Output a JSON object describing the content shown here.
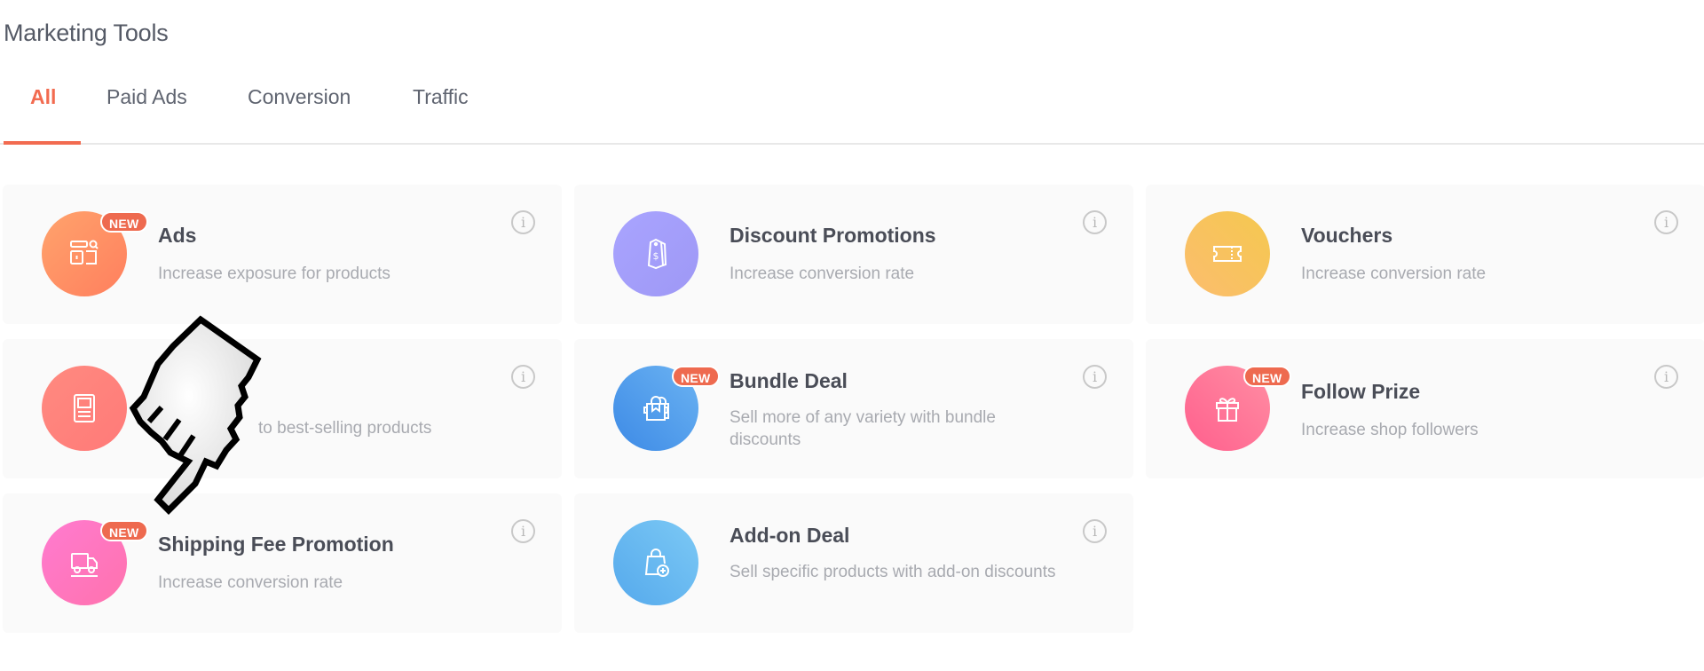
{
  "page": {
    "title": "Marketing Tools"
  },
  "tabs": [
    {
      "label": "All",
      "active": true
    },
    {
      "label": "Paid Ads",
      "active": false
    },
    {
      "label": "Conversion",
      "active": false
    },
    {
      "label": "Traffic",
      "active": false
    }
  ],
  "badge_label": "NEW",
  "info_glyph": "i",
  "tools": [
    {
      "title": "Ads",
      "description": "Increase exposure for products",
      "icon": "ads-icon",
      "badge": "NEW",
      "color": "#ff8c61"
    },
    {
      "title": "Discount Promotions",
      "description": "Increase conversion rate",
      "icon": "price-tag-icon",
      "badge": null,
      "color": "#a5a0f8"
    },
    {
      "title": "Vouchers",
      "description": "Increase conversion rate",
      "icon": "ticket-icon",
      "badge": null,
      "color": "#f7c35a"
    },
    {
      "title": "",
      "description": "to best-selling products",
      "icon": "document-icon",
      "badge": null,
      "color": "#ff807a"
    },
    {
      "title": "Bundle Deal",
      "description": "Sell more of any variety with bundle discounts",
      "icon": "shopping-bags-icon",
      "badge": "NEW",
      "color": "#4d98ea"
    },
    {
      "title": "Follow Prize",
      "description": "Increase shop followers",
      "icon": "gift-icon",
      "badge": "NEW",
      "color": "#ff6e96"
    },
    {
      "title": "Shipping Fee Promotion",
      "description": "Increase conversion rate",
      "icon": "truck-icon",
      "badge": "NEW",
      "color": "#ff78b8"
    },
    {
      "title": "Add-on Deal",
      "description": "Sell specific products with add-on discounts",
      "icon": "bag-plus-icon",
      "badge": null,
      "color": "#62b7f0"
    }
  ]
}
